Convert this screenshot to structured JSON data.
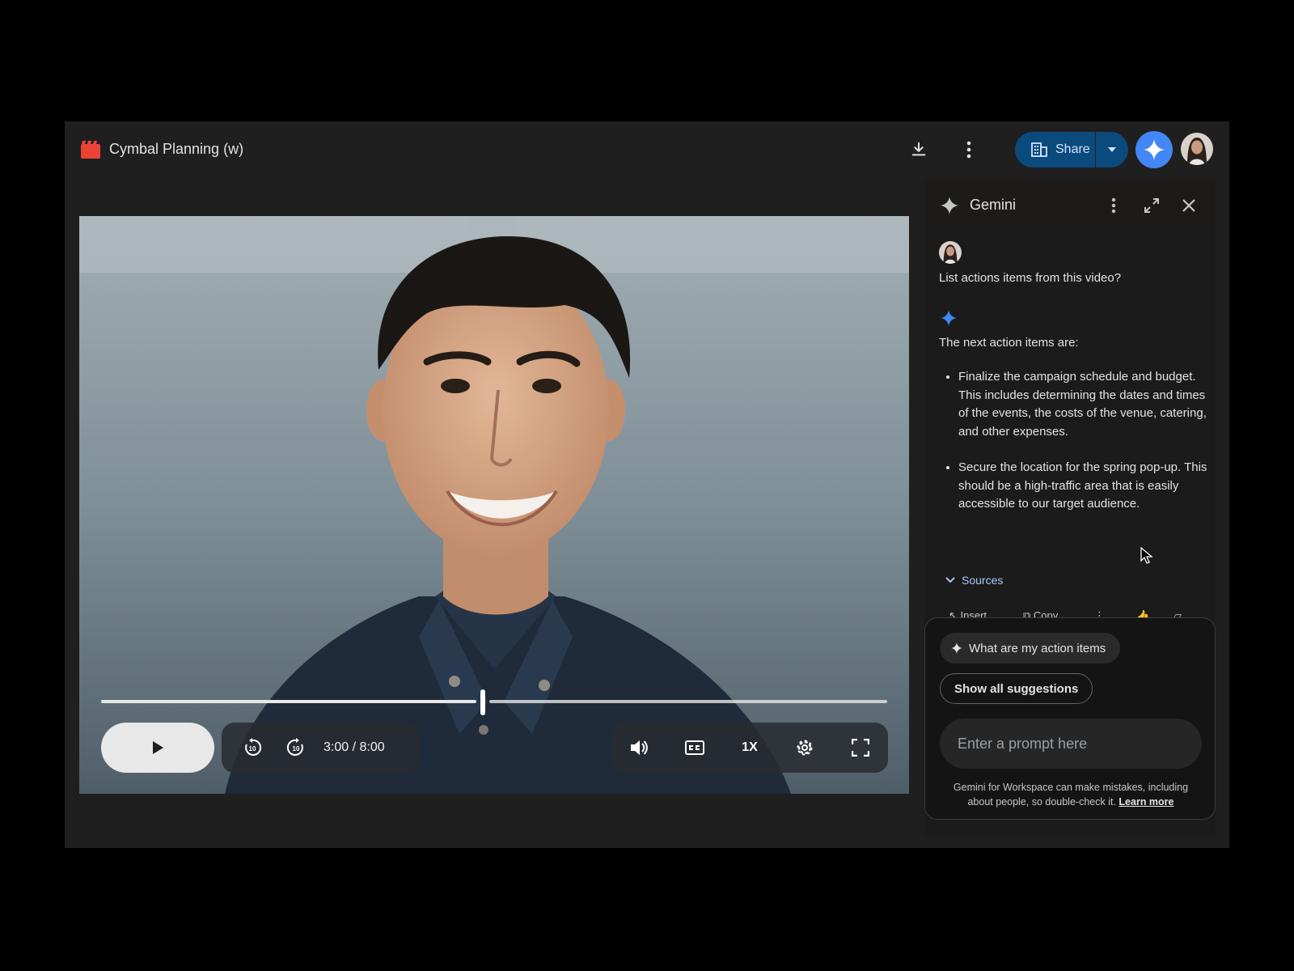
{
  "header": {
    "title": "Cymbal Planning (w)",
    "share_label": "Share"
  },
  "player": {
    "time": "3:00 / 8:00",
    "progress": 0.375,
    "speed": "1X",
    "rewind_seconds": "10",
    "forward_seconds": "10"
  },
  "gemini": {
    "title": "Gemini",
    "user_message": "List actions items from this video?",
    "response_intro": "The next action items are:",
    "response_items": [
      "Finalize the campaign schedule and budget. This includes determining the dates and times of the events, the costs of the venue, catering, and other expenses.",
      "Secure the location for the spring pop-up. This should be a high-traffic area that is easily accessible to our target audience."
    ],
    "sources_label": "Sources",
    "actions": {
      "insert": "Insert",
      "copy": "Copy"
    },
    "suggestion_chip": "What are my action items",
    "show_all_label": "Show all suggestions",
    "prompt_placeholder": "Enter a prompt here",
    "disclaimer": "Gemini for Workspace can make mistakes, including about people, so double-check it.",
    "learn_more": "Learn more"
  },
  "colors": {
    "accent": "#4287f5",
    "share_bg": "#0b4a7d",
    "app_bg": "#1f1f1f"
  },
  "icons": [
    "video-file-icon",
    "download-icon",
    "more-vert-icon",
    "share-org-icon",
    "gemini-spark-icon",
    "play-icon",
    "rewind-icon",
    "forward-icon",
    "volume-icon",
    "captions-icon",
    "settings-icon",
    "fullscreen-icon",
    "expand-icon",
    "close-icon",
    "chevron-down-icon"
  ]
}
